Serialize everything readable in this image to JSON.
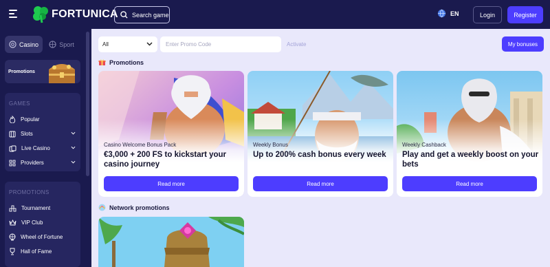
{
  "header": {
    "brand": "FORTUNICA",
    "search_label": "Search game",
    "language": "EN",
    "login_label": "Login",
    "register_label": "Register"
  },
  "sidebar": {
    "switch": [
      {
        "label": "Casino",
        "icon": "casino-chip-icon",
        "active": true
      },
      {
        "label": "Sport",
        "icon": "ball-icon",
        "active": false
      }
    ],
    "promotions_card_label": "Promotions",
    "games_heading": "GAMES",
    "games": [
      {
        "label": "Popular",
        "icon": "flame-icon",
        "expandable": false
      },
      {
        "label": "Slots",
        "icon": "slots-icon",
        "expandable": true
      },
      {
        "label": "Live Casino",
        "icon": "live-casino-icon",
        "expandable": true
      },
      {
        "label": "Providers",
        "icon": "grid-icon",
        "expandable": true
      }
    ],
    "promotions_heading": "PROMOTIONS",
    "promotions": [
      {
        "label": "Tournament",
        "icon": "tournament-icon"
      },
      {
        "label": "VIP Club",
        "icon": "crown-icon"
      },
      {
        "label": "Wheel of Fortune",
        "icon": "wheel-icon"
      },
      {
        "label": "Hall of Fame",
        "icon": "trophy-icon"
      }
    ]
  },
  "filters": {
    "category_value": "All",
    "promo_placeholder": "Enter Promo Code",
    "activate_label": "Activate",
    "my_bonuses_label": "My bonuses"
  },
  "sections": {
    "promotions_title": "Promotions",
    "network_title": "Network promotions"
  },
  "cards": [
    {
      "kicker": "Casino Welcome Bonus Pack",
      "headline": "€3,000 + 200 FS to kickstart your casino journey",
      "button": "Read more"
    },
    {
      "kicker": "Weekly Bonus",
      "headline": "Up to 200% cash bonus every week",
      "button": "Read more"
    },
    {
      "kicker": "Weekly Cashback",
      "headline": "Play and get a weekly boost on your bets",
      "button": "Read more"
    }
  ],
  "colors": {
    "navy": "#1a1a4e",
    "accent": "#4d3dff",
    "background": "#e9e8fb",
    "brand_green": "#1ecb4f"
  }
}
